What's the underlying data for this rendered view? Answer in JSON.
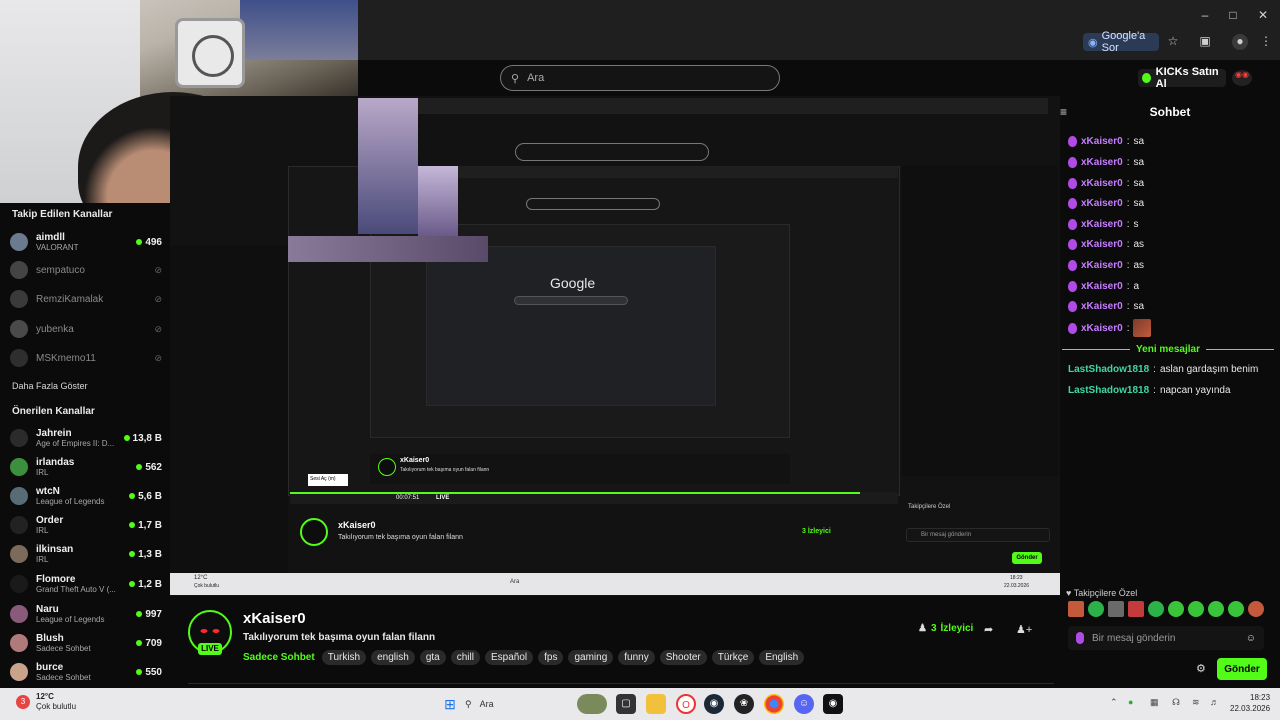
{
  "browser": {
    "ask_google": "Google'a Sor",
    "window_controls": [
      "minimize-icon",
      "maximize-icon",
      "close-icon"
    ]
  },
  "header": {
    "search_placeholder": "Ara",
    "kicks_label": "KICKs Satın Al"
  },
  "sidebar": {
    "followed_heading": "Takip Edilen Kanallar",
    "followed": [
      {
        "name": "aimdll",
        "category": "VALORANT",
        "viewers": "496",
        "online": true
      },
      {
        "name": "sempatuco",
        "category": "",
        "viewers": "",
        "online": false
      },
      {
        "name": "RemziKamalak",
        "category": "",
        "viewers": "",
        "online": false
      },
      {
        "name": "yubenka",
        "category": "",
        "viewers": "",
        "online": false
      },
      {
        "name": "MSKmemo11",
        "category": "",
        "viewers": "",
        "online": false
      }
    ],
    "show_more": "Daha Fazla Göster",
    "recommended_heading": "Önerilen Kanallar",
    "recommended": [
      {
        "name": "Jahrein",
        "category": "Age of Empires II: D...",
        "viewers": "13,8 B"
      },
      {
        "name": "irlandas",
        "category": "IRL",
        "viewers": "562"
      },
      {
        "name": "wtcN",
        "category": "League of Legends",
        "viewers": "5,6 B"
      },
      {
        "name": "Order",
        "category": "IRL",
        "viewers": "1,7 B"
      },
      {
        "name": "ilkinsan",
        "category": "IRL",
        "viewers": "1,3 B"
      },
      {
        "name": "Flomore",
        "category": "Grand Theft Auto V (...",
        "viewers": "1,2 B"
      },
      {
        "name": "Naru",
        "category": "League of Legends",
        "viewers": "997"
      },
      {
        "name": "Blush",
        "category": "Sadece Sohbet",
        "viewers": "709"
      },
      {
        "name": "burce",
        "category": "Sadece Sohbet",
        "viewers": "550"
      }
    ]
  },
  "stream": {
    "google_wordmark": "Google",
    "mini_channel": "xKaiser0",
    "mini_title": "Takılıyorum tek başıma oyun falan filann",
    "mini_viewers": "3 İzleyici",
    "mini_time": "00:07:51",
    "mini_live": "LIVE",
    "mini_tooltip": "Sesi Aç (m)",
    "mini_send": "Gönder",
    "mini_input": "Bir mesaj gönderin",
    "mini_sub": "Takipçilere Özel",
    "mini_weather": "12°C",
    "mini_weather_desc": "Çok bulutlu",
    "mini_clock": "18:23",
    "mini_date": "22.03.2026"
  },
  "channel": {
    "name": "xKaiser0",
    "live": "LIVE",
    "title": "Takılıyorum tek başıma oyun falan filann",
    "category": "Sadece Sohbet",
    "tags": [
      "Turkish",
      "english",
      "gta",
      "chill",
      "Español",
      "fps",
      "gaming",
      "funny",
      "Shooter",
      "Türkçe",
      "English"
    ],
    "viewers_count": "3",
    "viewers_label": "İzleyici"
  },
  "chat": {
    "title": "Sohbet",
    "messages": [
      {
        "user": "xKaiser0",
        "text": "sa"
      },
      {
        "user": "xKaiser0",
        "text": "sa"
      },
      {
        "user": "xKaiser0",
        "text": "sa"
      },
      {
        "user": "xKaiser0",
        "text": "sa"
      },
      {
        "user": "xKaiser0",
        "text": "s"
      },
      {
        "user": "xKaiser0",
        "text": "as"
      },
      {
        "user": "xKaiser0",
        "text": "as"
      },
      {
        "user": "xKaiser0",
        "text": "a"
      },
      {
        "user": "xKaiser0",
        "text": "sa"
      },
      {
        "user": "xKaiser0",
        "text": ""
      }
    ],
    "new_messages": "Yeni mesajlar",
    "new": [
      {
        "user": "LastShadow1818",
        "text": "aslan gardaşım benim"
      },
      {
        "user": "LastShadow1818",
        "text": "napcan yayında"
      }
    ],
    "subscribers_label": "Takipçilere Özel",
    "input_placeholder": "Bir mesaj gönderin",
    "send": "Gönder"
  },
  "taskbar": {
    "weather_temp": "12°C",
    "weather_desc": "Çok bulutlu",
    "search": "Ara",
    "time": "18:23",
    "date": "22.03.2026"
  },
  "colors": {
    "accent": "#53fc18",
    "chat_user": "#c77dff",
    "chat_user_new": "#42d6a4",
    "background": "#0b0b0c"
  }
}
